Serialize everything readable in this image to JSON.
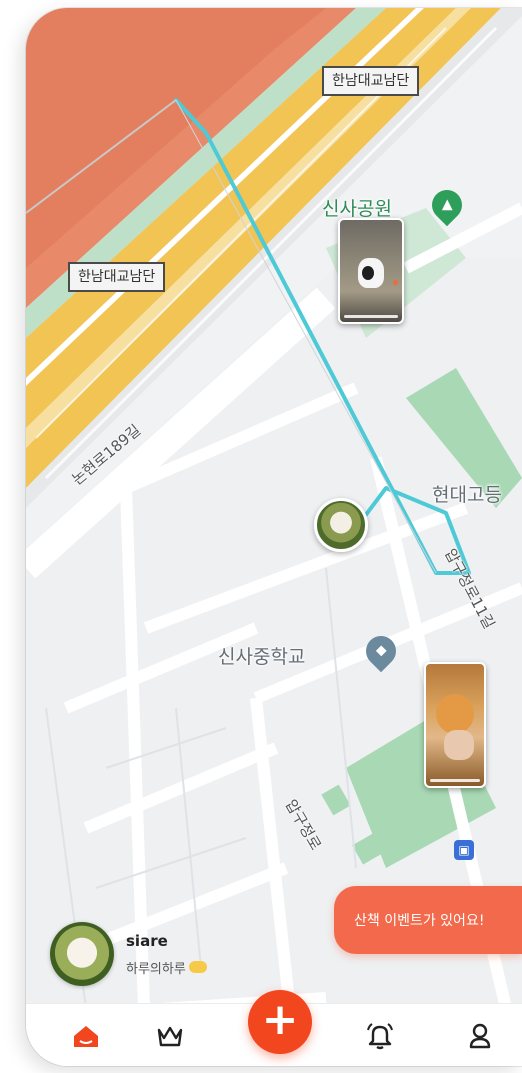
{
  "map": {
    "labels": {
      "bridge_top": "한남대교남단",
      "bridge_left": "한남대교남단",
      "park": "신사공원",
      "hyundai": "현대고등",
      "school": "신사중학교",
      "road_nonhyeon": "논현로189길",
      "road_apgujeong11": "압구정로11길",
      "road_apgujeong": "압구정로"
    },
    "icons": {
      "park_pin": "tree-icon",
      "school_pin": "graduation-cap-icon",
      "bus_stop": "bus-icon"
    },
    "colors": {
      "route": "#4ec9d6",
      "river_zone": "#e8896a",
      "highway": "#f1c453",
      "green_area": "#a8d8b4"
    }
  },
  "user": {
    "name": "siare",
    "status": "하루의하루"
  },
  "event_banner": {
    "text": "산책 이벤트가 있어요!",
    "color": "#f26a4b"
  },
  "fab": {
    "label": "+",
    "color": "#f2461e"
  },
  "nav": {
    "items": [
      {
        "name": "home",
        "icon": "home-icon",
        "active": true
      },
      {
        "name": "ranking",
        "icon": "crown-icon",
        "active": false
      },
      {
        "name": "notifications",
        "icon": "bell-icon",
        "active": false
      },
      {
        "name": "profile",
        "icon": "person-icon",
        "active": false
      }
    ],
    "active_color": "#f2461e"
  }
}
